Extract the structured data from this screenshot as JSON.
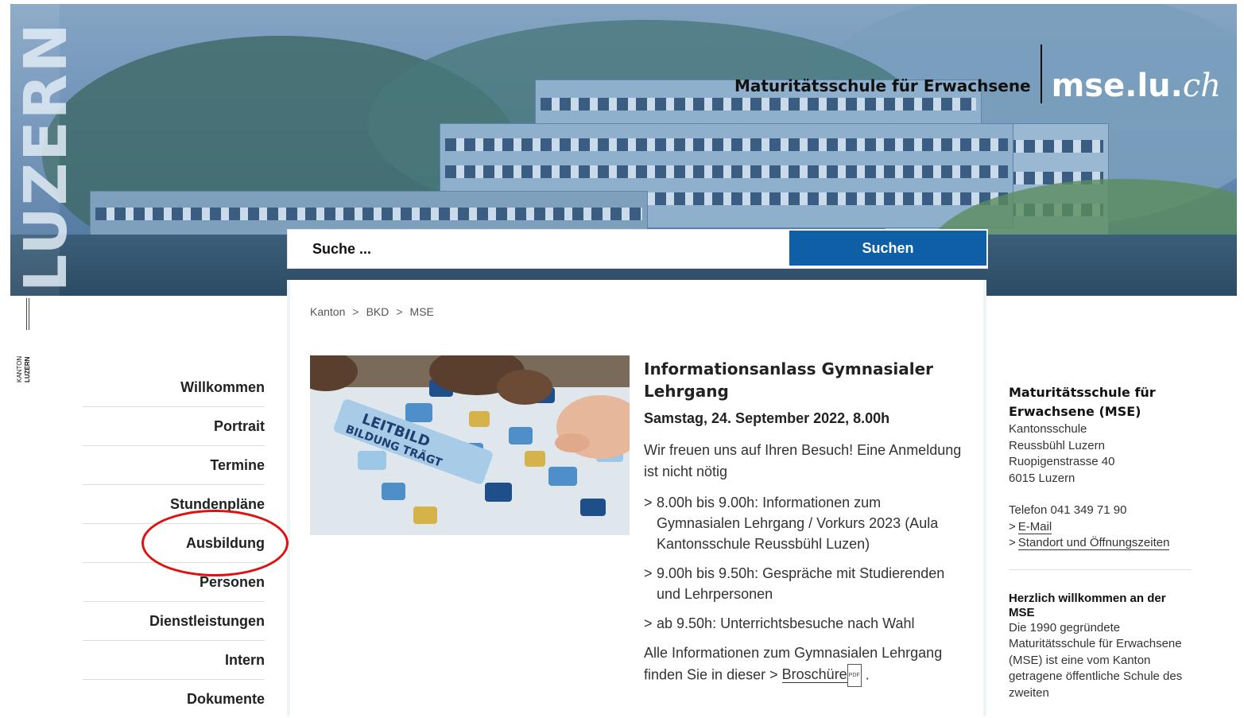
{
  "header": {
    "vertical_brand": "LUZERN",
    "school_name": "Maturitätsschule für Erwachsene",
    "domain_main": "mse.lu.",
    "domain_tld": "ch",
    "kanton_logo_line1": "KANTON",
    "kanton_logo_line2": "LUZERN"
  },
  "search": {
    "placeholder": "Suche ...",
    "button_label": "Suchen"
  },
  "breadcrumb": [
    "Kanton",
    "BKD",
    "MSE"
  ],
  "breadcrumb_separator": ">",
  "left_nav": [
    "Willkommen",
    "Portrait",
    "Termine",
    "Stundenpläne",
    "Ausbildung",
    "Personen",
    "Dienstleistungen",
    "Intern",
    "Dokumente"
  ],
  "article": {
    "title": "Informationsanlass Gymnasialer Lehrgang",
    "date": "Samstag, 24. September 2022, 8.00h",
    "intro": "Wir freuen uns auf Ihren Besuch! Eine Anmeldung ist nicht nötig",
    "bullets": [
      "8.00h bis 9.00h: Informationen zum Gymnasialen Lehrgang / Vorkurs 2023 (Aula Kantonsschule Reussbühl Luzen)",
      "9.00h bis 9.50h: Gespräche mit Studierenden und Lehrpersonen",
      "ab 9.50h: Unterrichtsbesuche nach Wahl"
    ],
    "outro_text": "Alle Informationen zum Gymnasialen Lehrgang finden Sie in dieser",
    "outro_link": "Broschüre",
    "outro_end": ".",
    "pdf_badge": "PDF",
    "image_text_1": "LEITBILD",
    "image_text_2": "BILDUNG TRÄGT"
  },
  "sidebar": {
    "org_title": "Maturitätsschule für Erwachsene (MSE)",
    "address": [
      "Kantonsschule",
      "Reussbühl Luzern",
      "Ruopigenstrasse 40",
      "6015 Luzern"
    ],
    "phone": "Telefon 041 349 71 90",
    "links": [
      "E-Mail",
      "Standort und Öffnungszeiten"
    ],
    "welcome_title": "Herzlich willkommen an der MSE",
    "welcome_text": "Die 1990 gegründete Maturitätsschule für Erwachsene (MSE) ist eine vom Kanton getragene öffentliche Schule des zweiten"
  },
  "colors": {
    "accent_blue": "#0f5fa6",
    "highlight_circle": "#e01010"
  }
}
